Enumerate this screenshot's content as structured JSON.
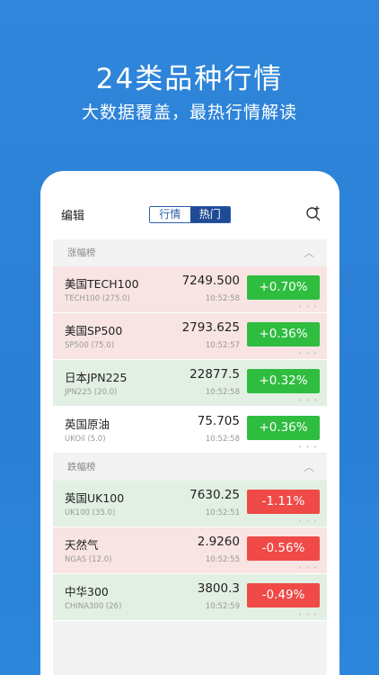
{
  "headline": "24类品种行情",
  "subline": "大数据覆盖，最热行情解读",
  "topbar": {
    "edit_label": "编辑",
    "tab_quotes": "行情",
    "tab_hot": "热门"
  },
  "gainers": {
    "title": "涨幅榜",
    "chevron": "︿",
    "rows": [
      {
        "name": "美国TECH100",
        "code": "TECH100 (275.0)",
        "price": "7249.500",
        "time": "10:52:58",
        "change": "+0.70%"
      },
      {
        "name": "美国SP500",
        "code": "SP500 (75.0)",
        "price": "2793.625",
        "time": "10:52:57",
        "change": "+0.36%"
      },
      {
        "name": "日本JPN225",
        "code": "JPN225 (20.0)",
        "price": "22877.5",
        "time": "10:52:58",
        "change": "+0.32%"
      },
      {
        "name": "英国原油",
        "code": "UKOil (5.0)",
        "price": "75.705",
        "time": "10:52:58",
        "change": "+0.36%"
      }
    ]
  },
  "losers": {
    "title": "跌幅榜",
    "chevron": "︿",
    "rows": [
      {
        "name": "英国UK100",
        "code": "UK100 (35.0)",
        "price": "7630.25",
        "time": "10:52:51",
        "change": "-1.11%"
      },
      {
        "name": "天然气",
        "code": "NGAS (12.0)",
        "price": "2.9260",
        "time": "10:52:55",
        "change": "-0.56%"
      },
      {
        "name": "中华300",
        "code": "CHINA300 (26)",
        "price": "3800.3",
        "time": "10:52:59",
        "change": "-0.49%"
      }
    ]
  },
  "more_dots": "• • •",
  "colors": {
    "background": "#2f86da",
    "up": "#2ebd3f",
    "down": "#ef4a48",
    "accent": "#1e4a96"
  }
}
